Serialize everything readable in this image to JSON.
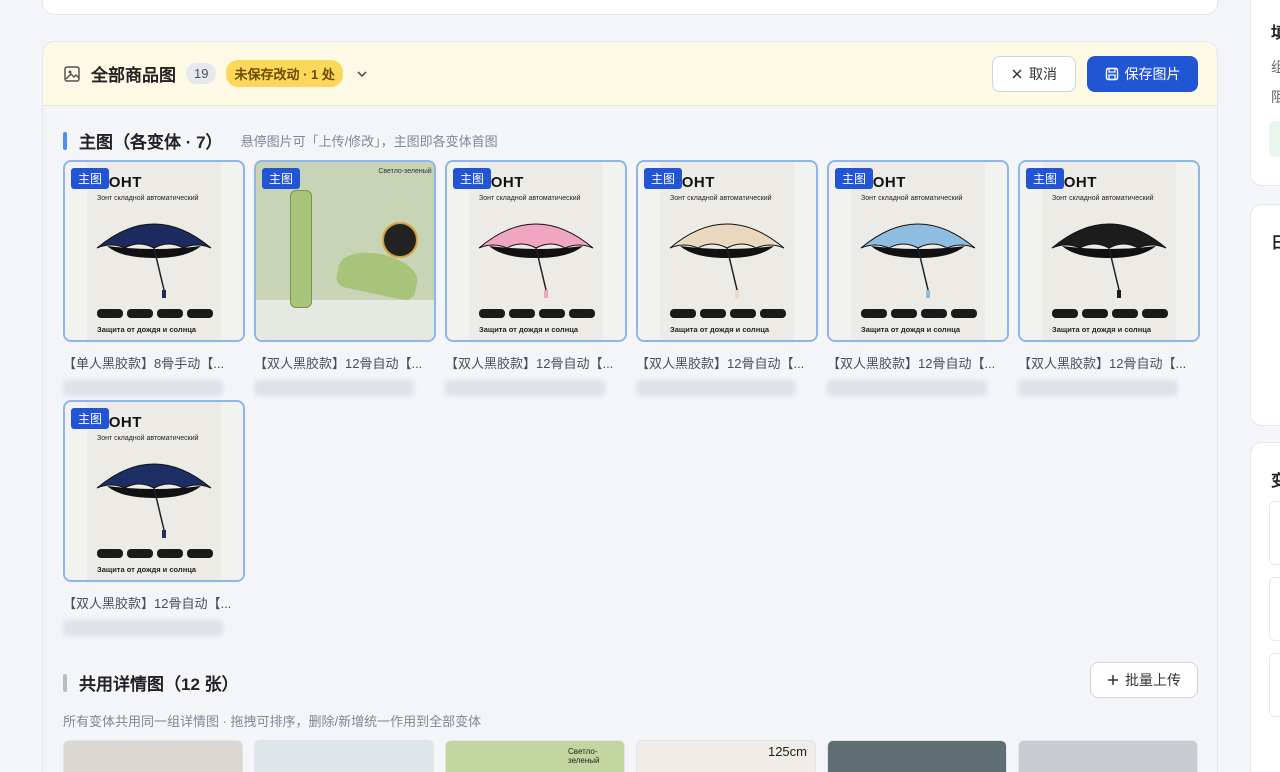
{
  "header": {
    "title": "全部商品图",
    "count": "19",
    "unsaved": "未保存改动 · 1 处",
    "cancel_label": "取消",
    "save_label": "保存图片"
  },
  "main_section": {
    "title": "主图（各变体 · 7）",
    "hint": "悬停图片可「上传/修改」，主图即各变体首图",
    "tag": "主图",
    "poster": {
      "brand": "ЗОНТ",
      "sub": "Зонт складной автоматический",
      "foot": "Защита от дождя и солнца"
    },
    "items": [
      {
        "caption": "【单人黑胶款】8骨手动【...",
        "canopy": "#1d2a5e",
        "style": "poster"
      },
      {
        "caption": "【双人黑胶款】12骨自动【...",
        "canopy": "#a8c47a",
        "style": "green",
        "label_top": "Светло-зеленый"
      },
      {
        "caption": "【双人黑胶款】12骨自动【...",
        "canopy": "#f0a6c0",
        "style": "poster"
      },
      {
        "caption": "【双人黑胶款】12骨自动【...",
        "canopy": "#ead9be",
        "style": "poster"
      },
      {
        "caption": "【双人黑胶款】12骨自动【...",
        "canopy": "#8fbde0",
        "style": "poster"
      },
      {
        "caption": "【双人黑胶款】12骨自动【...",
        "canopy": "#1c1c1c",
        "style": "poster"
      },
      {
        "caption": "【双人黑胶款】12骨自动【...",
        "canopy": "#1d2e64",
        "style": "poster"
      }
    ]
  },
  "detail_section": {
    "title": "共用详情图（12 张）",
    "upload_label": "批量上传",
    "hint": "所有变体共用同一组详情图 · 拖拽可排序，删除/新增统一作用到全部变体",
    "thumbs": [
      {
        "text": ""
      },
      {
        "text": ""
      },
      {
        "text": "Светло-зеленый"
      },
      {
        "text": "125cm"
      },
      {
        "text": ""
      },
      {
        "text": ""
      }
    ]
  },
  "right_panel": {
    "card1_title": "填",
    "card1_line1": "组",
    "card1_line2": "阻",
    "card2_title": "日",
    "card3_title": "变"
  },
  "colors": {
    "accent": "#2255d4",
    "unsaved": "#fbd85a",
    "header_bg": "#fdf9e4",
    "main_bar": "#4d8ff0",
    "detail_bar": "#b8bcc6"
  }
}
